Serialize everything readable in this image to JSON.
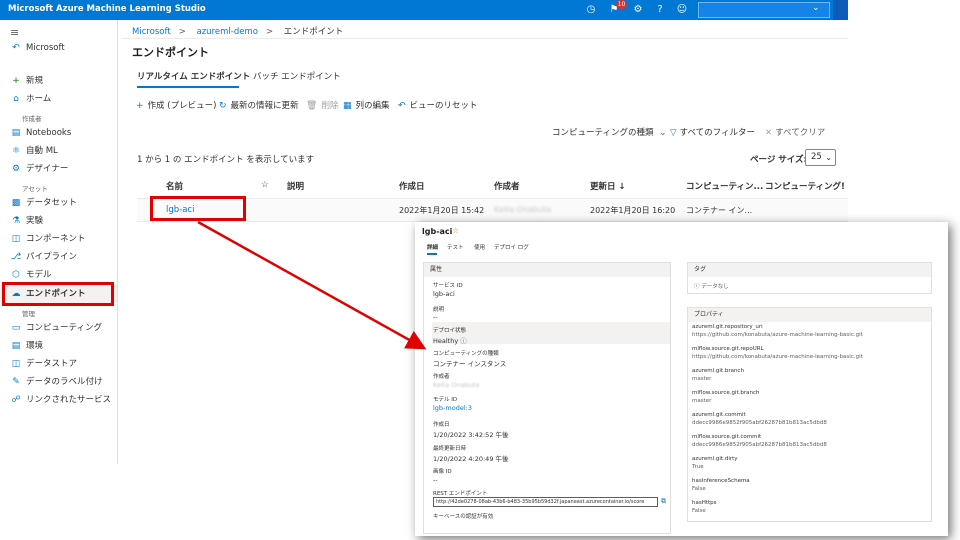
{
  "topbar": {
    "title": "Microsoft Azure Machine Learning Studio",
    "notification_count": "10",
    "icons": [
      "clock-icon",
      "bell-icon",
      "gear-icon",
      "help-icon",
      "smiley-icon"
    ]
  },
  "sidebar": {
    "hamburger": "≡",
    "back": "Microsoft",
    "items_top": [
      {
        "label": "新規",
        "icon": "plus-icon"
      },
      {
        "label": "ホーム",
        "icon": "home-icon"
      }
    ],
    "group_author": "作成者",
    "items_author": [
      {
        "label": "Notebooks",
        "icon": "notebook-icon"
      },
      {
        "label": "自動 ML",
        "icon": "automl-icon"
      },
      {
        "label": "デザイナー",
        "icon": "designer-icon"
      }
    ],
    "group_assets": "アセット",
    "items_assets": [
      {
        "label": "データセット",
        "icon": "dataset-icon"
      },
      {
        "label": "実験",
        "icon": "experiment-icon"
      },
      {
        "label": "コンポーネント",
        "icon": "component-icon"
      },
      {
        "label": "パイプライン",
        "icon": "pipeline-icon"
      },
      {
        "label": "モデル",
        "icon": "model-icon"
      },
      {
        "label": "エンドポイント",
        "icon": "endpoint-icon"
      }
    ],
    "group_manage": "管理",
    "items_manage": [
      {
        "label": "コンピューティング",
        "icon": "compute-icon"
      },
      {
        "label": "環境",
        "icon": "environment-icon"
      },
      {
        "label": "データストア",
        "icon": "datastore-icon"
      },
      {
        "label": "データのラベル付け",
        "icon": "labeling-icon"
      },
      {
        "label": "リンクされたサービス",
        "icon": "linked-services-icon"
      }
    ]
  },
  "breadcrumb": [
    "Microsoft",
    "azureml-demo",
    "エンドポイント"
  ],
  "page_title": "エンドポイント",
  "tabs": [
    "リアルタイム エンドポイント",
    "バッチ エンドポイント"
  ],
  "toolbar": {
    "create": "作成 (プレビュー)",
    "refresh": "最新の情報に更新",
    "delete": "削除",
    "edit_columns": "列の編集",
    "reset_view": "ビューのリセット"
  },
  "filters": {
    "compute_type": "コンピューティングの種類",
    "all_filters": "すべてのフィルター",
    "clear_all": "すべてクリア"
  },
  "summary": "1 から 1 の エンドポイント を表示しています",
  "page_size": {
    "label": "ページ サイズ:",
    "value": "25"
  },
  "table": {
    "headers": [
      "名前",
      "☆",
      "説明",
      "作成日",
      "作成者",
      "更新日 ↓",
      "コンピューティン...",
      "コンピューティング!"
    ],
    "rows": [
      {
        "name": "lgb-aci",
        "created": "2022年1月20日 15:42",
        "creator": "Keita Onabuta",
        "updated": "2022年1月20日 16:20",
        "compute": "コンテナー イン..."
      }
    ]
  },
  "detail": {
    "title": "lgb-aci",
    "tabs": [
      "詳細",
      "テスト",
      "使用",
      "デプロイ ログ"
    ],
    "attributes": {
      "header": "属性",
      "service_id_label": "サービス ID",
      "service_id": "lgb-aci",
      "description_label": "説明",
      "description": "--",
      "deploy_state_label": "デプロイ状態",
      "deploy_state": "Healthy",
      "compute_type_label": "コンピューティングの種類",
      "compute_type": "コンテナー インスタンス",
      "creator_label": "作成者",
      "creator": "Keita Onabuta",
      "model_id_label": "モデル ID",
      "model_id": "lgb-model:3",
      "created_label": "作成日",
      "created": "1/20/2022 3:42:52 午後",
      "updated_label": "最終更新日時",
      "updated": "1/20/2022 4:20:49 午後",
      "image_id_label": "画像 ID",
      "image_id": "--",
      "rest_label": "REST エンドポイント",
      "rest": "http://42de0278-08ab-43b6-b483-35b95b59d32f.japaneast.azurecontainer.io/score",
      "key_auth_label": "キーベースの認証が有効"
    },
    "tags": {
      "header": "タグ",
      "empty": "データなし"
    },
    "properties": {
      "header": "プロパティ",
      "items": [
        {
          "key": "azureml.git.repository_uri",
          "value": "https://github.com/konabuta/azure-machine-learning-basic.git"
        },
        {
          "key": "mlflow.source.git.repoURL",
          "value": "https://github.com/konabuta/azure-machine-learning-basic.git"
        },
        {
          "key": "azureml.git.branch",
          "value": "master"
        },
        {
          "key": "mlflow.source.git.branch",
          "value": "master"
        },
        {
          "key": "azureml.git.commit",
          "value": "ddecc9986e9852f905abf26287b81b813ac5dbd8"
        },
        {
          "key": "mlflow.source.git.commit",
          "value": "ddecc9986e9852f905abf26287b81b813ac5dbd8"
        },
        {
          "key": "azureml.git.dirty",
          "value": "True"
        },
        {
          "key": "hasInferenceSchema",
          "value": "False"
        },
        {
          "key": "hasHttps",
          "value": "False"
        }
      ]
    }
  }
}
